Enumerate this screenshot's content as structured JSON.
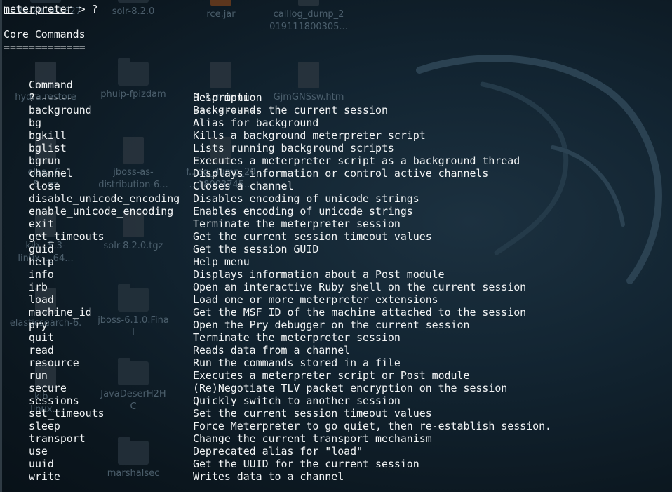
{
  "desktop": {
    "icons": [
      {
        "label": "CVE-2019-1627",
        "kind": "folder"
      },
      {
        "label": "solr-8.2.0",
        "kind": "folder"
      },
      {
        "label": "rce.jar",
        "kind": "jar"
      },
      {
        "label": "calllog_dump_2\n019111800305...",
        "kind": "file"
      },
      {
        "label": "hydra.restore",
        "kind": "file"
      },
      {
        "label": "phuip-fpizdam",
        "kind": "folder"
      },
      {
        "label": "f...mux",
        "kind": "file"
      },
      {
        "label": "GjmGNSsw.htm",
        "kind": "file"
      },
      {
        "label": "elas...6.\n5...gz",
        "kind": "file"
      },
      {
        "label": "jboss-as-\ndistribution-6...",
        "kind": "zip"
      },
      {
        "label": "f...og_dump_20\n...18003745...",
        "kind": "file"
      },
      {
        "label": "kib...5.3-\nlinux..._64...",
        "kind": "file"
      },
      {
        "label": "solr-8.2.0.tgz",
        "kind": "tgz"
      },
      {
        "label": "elasticsearch-6.",
        "kind": "file"
      },
      {
        "label": "jboss-6.1.0.Fina\nl",
        "kind": "folder"
      },
      {
        "label": "kib...\nlinux...",
        "kind": "file"
      },
      {
        "label": "JavaDeserH2H\nC",
        "kind": "folder"
      },
      {
        "label": "marshalsec",
        "kind": "folder"
      }
    ]
  },
  "terminal": {
    "prompt_word": "meterpreter",
    "prompt_rest": " > ?",
    "section_title": "Core Commands",
    "section_rule": "=============",
    "header_command": "Command",
    "header_description": "Description",
    "rule_command": "-------",
    "rule_description": "-----------",
    "commands": [
      {
        "name": "?",
        "desc": "Help menu"
      },
      {
        "name": "background",
        "desc": "Backgrounds the current session"
      },
      {
        "name": "bg",
        "desc": "Alias for background"
      },
      {
        "name": "bgkill",
        "desc": "Kills a background meterpreter script"
      },
      {
        "name": "bglist",
        "desc": "Lists running background scripts"
      },
      {
        "name": "bgrun",
        "desc": "Executes a meterpreter script as a background thread"
      },
      {
        "name": "channel",
        "desc": "Displays information or control active channels"
      },
      {
        "name": "close",
        "desc": "Closes a channel"
      },
      {
        "name": "disable_unicode_encoding",
        "desc": "Disables encoding of unicode strings"
      },
      {
        "name": "enable_unicode_encoding",
        "desc": "Enables encoding of unicode strings"
      },
      {
        "name": "exit",
        "desc": "Terminate the meterpreter session"
      },
      {
        "name": "get_timeouts",
        "desc": "Get the current session timeout values"
      },
      {
        "name": "guid",
        "desc": "Get the session GUID"
      },
      {
        "name": "help",
        "desc": "Help menu"
      },
      {
        "name": "info",
        "desc": "Displays information about a Post module"
      },
      {
        "name": "irb",
        "desc": "Open an interactive Ruby shell on the current session"
      },
      {
        "name": "load",
        "desc": "Load one or more meterpreter extensions"
      },
      {
        "name": "machine_id",
        "desc": "Get the MSF ID of the machine attached to the session"
      },
      {
        "name": "pry",
        "desc": "Open the Pry debugger on the current session"
      },
      {
        "name": "quit",
        "desc": "Terminate the meterpreter session"
      },
      {
        "name": "read",
        "desc": "Reads data from a channel"
      },
      {
        "name": "resource",
        "desc": "Run the commands stored in a file"
      },
      {
        "name": "run",
        "desc": "Executes a meterpreter script or Post module"
      },
      {
        "name": "secure",
        "desc": "(Re)Negotiate TLV packet encryption on the session"
      },
      {
        "name": "sessions",
        "desc": "Quickly switch to another session"
      },
      {
        "name": "set_timeouts",
        "desc": "Set the current session timeout values"
      },
      {
        "name": "sleep",
        "desc": "Force Meterpreter to go quiet, then re-establish session."
      },
      {
        "name": "transport",
        "desc": "Change the current transport mechanism"
      },
      {
        "name": "use",
        "desc": "Deprecated alias for \"load\""
      },
      {
        "name": "uuid",
        "desc": "Get the UUID for the current session"
      },
      {
        "name": "write",
        "desc": "Writes data to a channel"
      }
    ]
  }
}
